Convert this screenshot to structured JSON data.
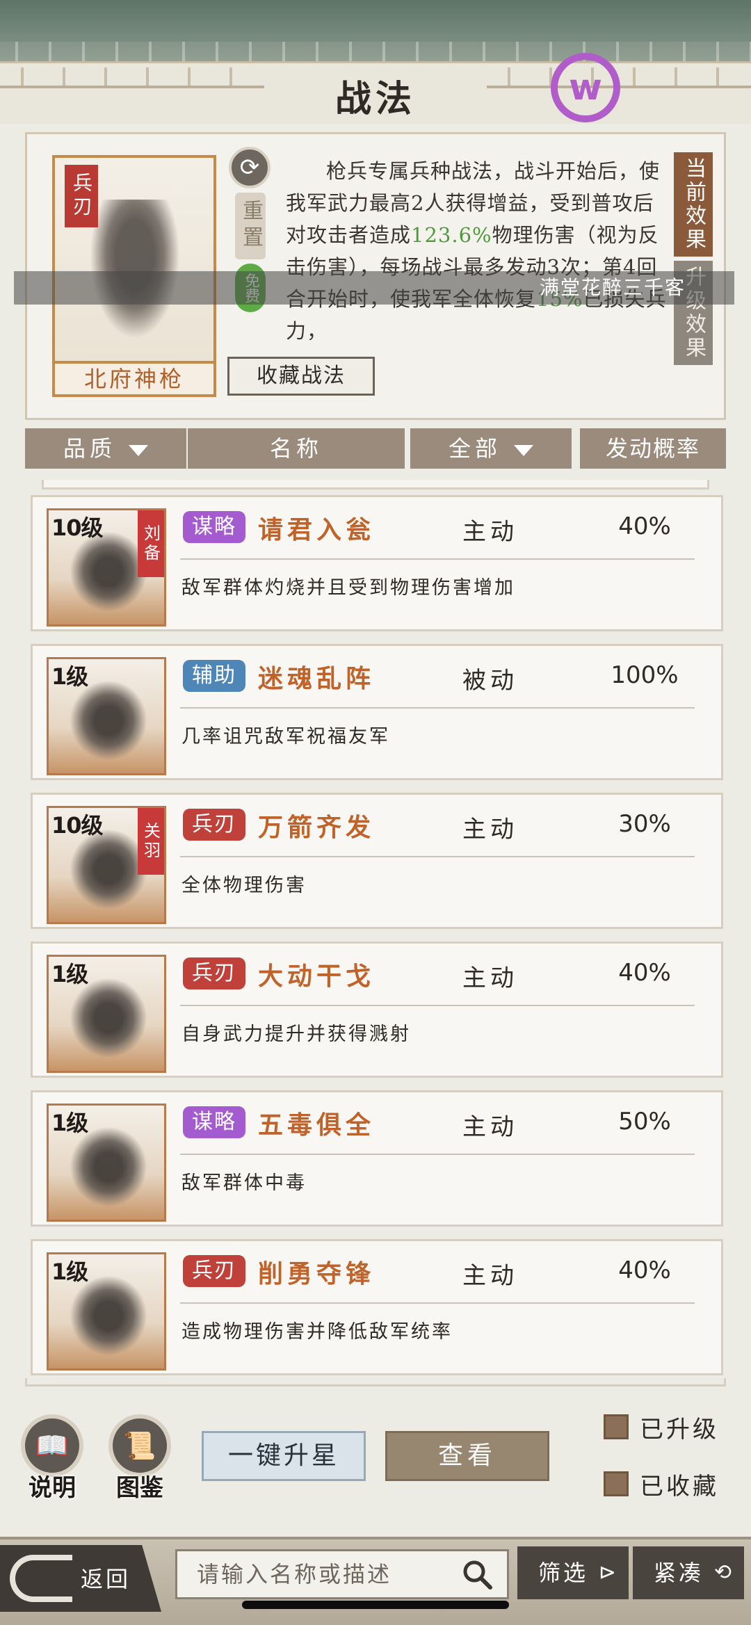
{
  "page": {
    "title": "战法"
  },
  "detail": {
    "portrait_tag": "兵刃",
    "portrait_name": "北府神枪",
    "reset_label": "重置",
    "free_label": "免费",
    "description": {
      "p1": "枪兵专属兵种战法，战斗开始后，使我军武力最高2人获得增益，受到普攻后对攻击者造成",
      "v1": "123.6%",
      "p2": "物理伤害（视为反击伤害），每场战斗最多发动3次；第4回合开始时，使我军全体恢复",
      "v2": "15%",
      "p3": "已损失兵力，"
    },
    "tab_current": "当前效果",
    "tab_upgrade": "升级效果",
    "collect_button": "收藏战法",
    "marquee": "满堂花醉三千客"
  },
  "columns": {
    "quality": "品质",
    "name": "名称",
    "all": "全部",
    "rate": "发动概率"
  },
  "skills": [
    {
      "level": "10级",
      "owner": "刘备",
      "type": "谋略",
      "type_color": "#a45bd0",
      "name": "请君入瓮",
      "mode": "主动",
      "rate": "40%",
      "desc": "敌军群体灼烧并且受到物理伤害增加"
    },
    {
      "level": "1级",
      "owner": "",
      "type": "辅助",
      "type_color": "#4f86b8",
      "name": "迷魂乱阵",
      "mode": "被动",
      "rate": "100%",
      "desc": "几率诅咒敌军祝福友军"
    },
    {
      "level": "10级",
      "owner": "关羽",
      "type": "兵刃",
      "type_color": "#c0403a",
      "name": "万箭齐发",
      "mode": "主动",
      "rate": "30%",
      "desc": "全体物理伤害"
    },
    {
      "level": "1级",
      "owner": "",
      "type": "兵刃",
      "type_color": "#c0403a",
      "name": "大动干戈",
      "mode": "主动",
      "rate": "40%",
      "desc": "自身武力提升并获得溅射"
    },
    {
      "level": "1级",
      "owner": "",
      "type": "谋略",
      "type_color": "#a45bd0",
      "name": "五毒俱全",
      "mode": "主动",
      "rate": "50%",
      "desc": "敌军群体中毒"
    },
    {
      "level": "1级",
      "owner": "",
      "type": "兵刃",
      "type_color": "#c0403a",
      "name": "削勇夺锋",
      "mode": "主动",
      "rate": "40%",
      "desc": "造成物理伤害并降低敌军统率"
    }
  ],
  "bottom": {
    "help_label": "说明",
    "codex_label": "图鉴",
    "star_button": "一键升星",
    "view_button": "查看",
    "check_upgraded": "已升级",
    "check_collected": "已收藏",
    "back_label": "返回",
    "search_placeholder": "请输入名称或描述",
    "filter_button": "筛选",
    "compact_button": "紧凑"
  }
}
